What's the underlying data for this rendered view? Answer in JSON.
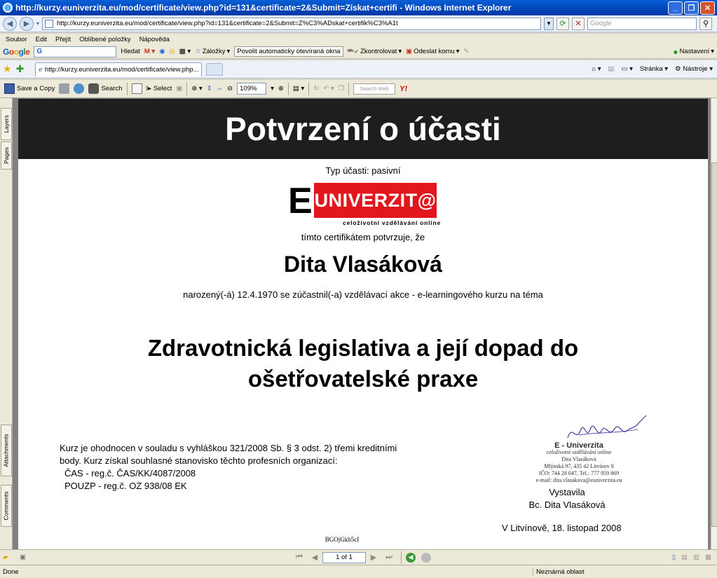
{
  "window": {
    "title": "http://kurzy.euniverzita.eu/mod/certificate/view.php?id=131&certificate=2&Submit=Získat+certifi - Windows Internet Explorer",
    "address": "http://kurzy.euniverzita.eu/mod/certificate/view.php?id=131&certificate=2&Submit=Z%C3%ADskat+certifik%C3%A1t",
    "search_placeholder": "Google"
  },
  "menu": {
    "items": [
      "Soubor",
      "Edit",
      "Přejít",
      "Oblíbené položky",
      "Nápověda"
    ]
  },
  "google_toolbar": {
    "search_text": "G",
    "search_label": "Hledat",
    "bookmarks": "Záložky",
    "popups": "Povolit automaticky otevíraná okna",
    "check": "Zkontrolovat",
    "send": "Odeslat komu",
    "settings": "Nastavení"
  },
  "tabs": {
    "active_tab": "http://kurzy.euniverzita.eu/mod/certificate/view.php...",
    "page_menu": "Stránka",
    "tools_menu": "Nástroje"
  },
  "acrobat_toolbar": {
    "save_copy": "Save a Copy",
    "search": "Search",
    "select": "Select",
    "zoom": "109%",
    "search_web": "Search Web"
  },
  "sidebar": {
    "layers": "Layers",
    "pages": "Pages",
    "attachments": "Attachments",
    "comments": "Comments"
  },
  "certificate": {
    "heading": "Potvrzení o účasti",
    "participation_type": "Typ účasti: pasivní",
    "logo_e": "E",
    "logo_brand": "UNIVERZIT@",
    "logo_tagline": "celoživotní vzdělávání online",
    "certifies": "tímto certifikátem potvrzuje, že",
    "person_name": "Dita Vlasáková",
    "born_line": "narozený(-á) 12.4.1970 se zúčastnil(-a) vzdělávací akce - e-learningového kurzu na téma",
    "course_line1": "Zdravotnická legislativa a její dopad do",
    "course_line2": "ošetřovatelské praxe",
    "credits_line1": "Kurz je ohodnocen v souladu s vyhláškou 321/2008 Sb. § 3 odst. 2) třemi kreditními",
    "credits_line2": "body. Kurz získal souhlasné stanovisko těchto profesních organizací:",
    "credits_line3": "ČAS - reg.č. ČAS/KK/4087/2008",
    "credits_line4": "POUZP - reg.č. OZ 938/08 EK",
    "stamp_line1": "E - Univerzita",
    "stamp_line2": "celoživotní vzdělávání online",
    "stamp_line3": "Dita Vlasáková",
    "stamp_line4": "Mlýnská 97, 435 42  Litvínov 8",
    "stamp_line5": "IČO: 744 28 047, Tel.: 777 959 869",
    "stamp_line6": "e-mail: dita.vlasakova@euniverzita.eu",
    "issued_by": "Vystavila",
    "issuer": "Bc. Dita Vlasáková",
    "place_date": "V Litvínově,  18. listopad 2008",
    "code": "BGOjGkb5cI"
  },
  "pager": {
    "page": "1 of 1"
  },
  "status": {
    "left": "Done",
    "zone": "Neznámá oblast"
  }
}
